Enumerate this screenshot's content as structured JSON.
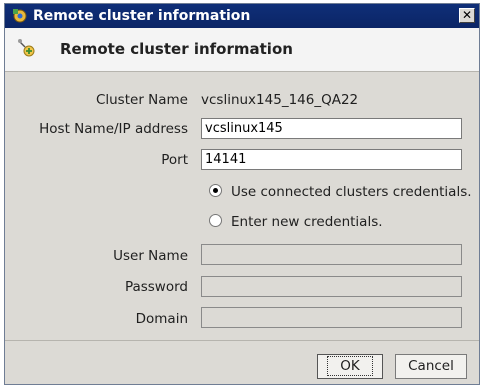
{
  "window": {
    "title": "Remote cluster information"
  },
  "header": {
    "title": "Remote cluster information"
  },
  "form": {
    "cluster_name_label": "Cluster Name",
    "cluster_name_value": "vcslinux145_146_QA22",
    "host_label": "Host Name/IP address",
    "host_value": "vcslinux145",
    "port_label": "Port",
    "port_value": "14141",
    "radio_connected_label": "Use connected clusters credentials.",
    "radio_new_label": "Enter new credentials.",
    "user_label": "User Name",
    "user_value": "",
    "password_label": "Password",
    "password_value": "",
    "domain_label": "Domain",
    "domain_value": ""
  },
  "buttons": {
    "ok_label": "OK",
    "cancel_label": "Cancel"
  },
  "icons": {
    "title_icon": "cluster-gear-icon",
    "header_icon": "add-cluster-icon",
    "close_icon": "close-icon"
  }
}
